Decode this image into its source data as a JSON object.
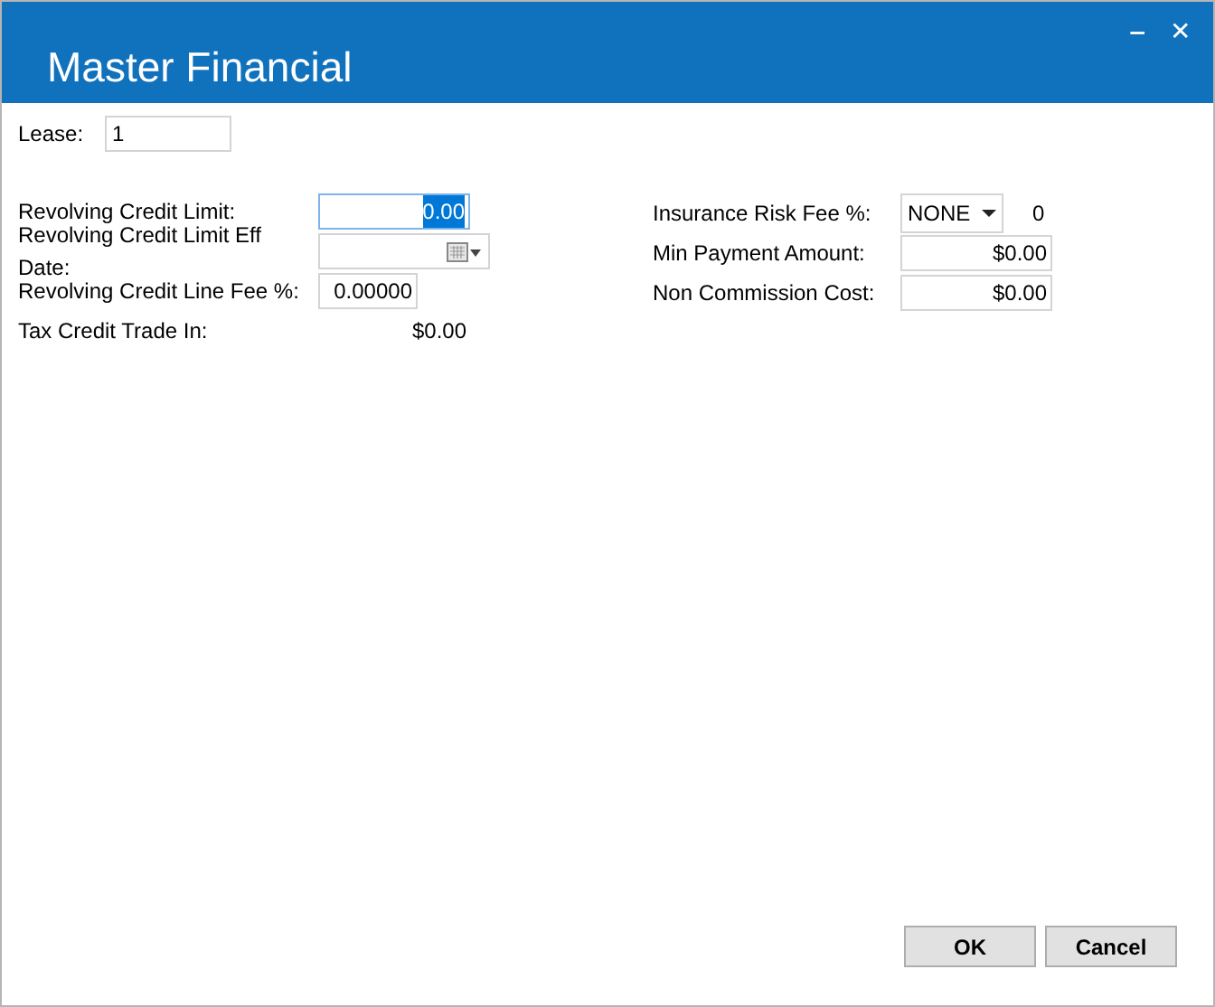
{
  "window": {
    "title": "Master Financial",
    "controls": [
      "‒",
      "✕"
    ]
  },
  "lease": {
    "label": "Lease:",
    "value": "1"
  },
  "left_fields": [
    {
      "label": "Revolving Credit Limit:",
      "kind": "input",
      "value": "0.00",
      "focused": true
    },
    {
      "label": "Revolving Credit Limit Eff Date:",
      "kind": "date",
      "focused": false
    },
    {
      "label": "Revolving Credit Line Fee %:",
      "kind": "input",
      "value": "0.00000",
      "focused": false
    },
    {
      "label": "Tax Credit Trade In:",
      "kind": "text",
      "value": "$0.00",
      "focused": false
    }
  ],
  "right_fields": [
    {
      "label": "Insurance Risk Fee %:",
      "kind": "dropdown",
      "value": "NONE",
      "reading": "0"
    },
    {
      "label": "Min Payment Amount:",
      "kind": "input",
      "value": "$0.00"
    },
    {
      "label": "Non Commission Cost:",
      "kind": "input",
      "value": "$0.00"
    }
  ],
  "buttons": [
    "OK",
    "Cancel"
  ]
}
